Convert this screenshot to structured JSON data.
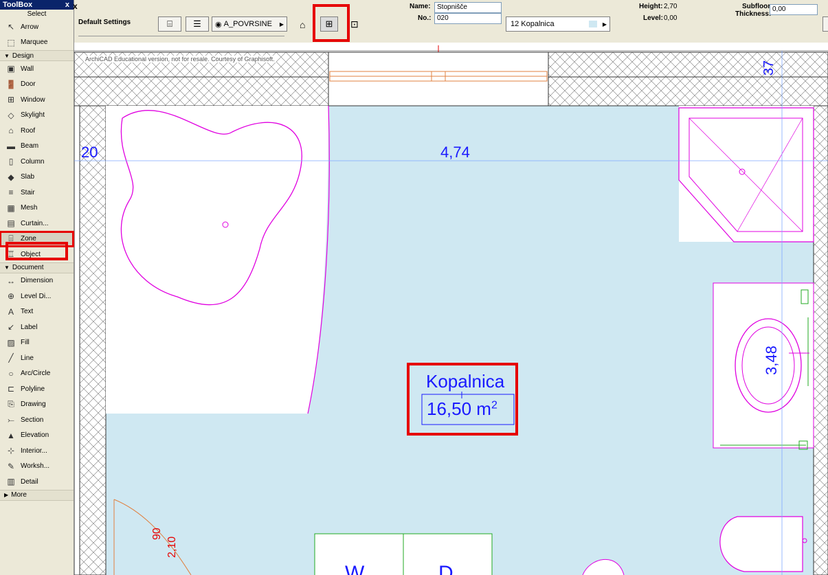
{
  "toolbox": {
    "title": "ToolBox",
    "close": "x",
    "select_label": "Select",
    "items_top": [
      {
        "label": "Arrow",
        "icon": "arrow-icon"
      },
      {
        "label": "Marquee",
        "icon": "marquee-icon"
      }
    ],
    "design_label": "Design",
    "design_items": [
      {
        "label": "Wall",
        "icon": "wall-icon"
      },
      {
        "label": "Door",
        "icon": "door-icon"
      },
      {
        "label": "Window",
        "icon": "window-icon"
      },
      {
        "label": "Skylight",
        "icon": "skylight-icon"
      },
      {
        "label": "Roof",
        "icon": "roof-icon"
      },
      {
        "label": "Beam",
        "icon": "beam-icon"
      },
      {
        "label": "Column",
        "icon": "column-icon"
      },
      {
        "label": "Slab",
        "icon": "slab-icon"
      },
      {
        "label": "Stair",
        "icon": "stair-icon"
      },
      {
        "label": "Mesh",
        "icon": "mesh-icon"
      },
      {
        "label": "Curtain...",
        "icon": "curtain-wall-icon"
      },
      {
        "label": "Zone",
        "icon": "zone-icon",
        "selected": true
      },
      {
        "label": "Object",
        "icon": "object-icon"
      }
    ],
    "document_label": "Document",
    "document_items": [
      {
        "label": "Dimension",
        "icon": "dimension-icon"
      },
      {
        "label": "Level Di...",
        "icon": "level-dimension-icon"
      },
      {
        "label": "Text",
        "icon": "text-icon"
      },
      {
        "label": "Label",
        "icon": "label-icon"
      },
      {
        "label": "Fill",
        "icon": "fill-icon"
      },
      {
        "label": "Line",
        "icon": "line-icon"
      },
      {
        "label": "Arc/Circle",
        "icon": "arc-circle-icon"
      },
      {
        "label": "Polyline",
        "icon": "polyline-icon"
      },
      {
        "label": "Drawing",
        "icon": "drawing-icon"
      },
      {
        "label": "Section",
        "icon": "section-icon"
      },
      {
        "label": "Elevation",
        "icon": "elevation-icon"
      },
      {
        "label": "Interior...",
        "icon": "interior-elevation-icon"
      },
      {
        "label": "Worksh...",
        "icon": "worksheet-icon"
      },
      {
        "label": "Detail",
        "icon": "detail-icon"
      }
    ],
    "more_label": "More"
  },
  "infobox": {
    "close": "x",
    "default_settings": "Default Settings",
    "layer": "A_POVRSINE",
    "name_label": "Name:",
    "name_value": "Stopnišče",
    "no_label": "No.:",
    "no_value": "020",
    "category": "12  Kopalnica",
    "height_label": "Height:",
    "height_value": "2,70",
    "level_label": "Level:",
    "level_value": "0,00",
    "subfloor_label1": "Subfloor",
    "subfloor_label2": "Thickness:",
    "subfloor_value": "0,00"
  },
  "drawing": {
    "watermark": "ArchiCAD Educational version, not for resale. Courtesy of Graphisoft.",
    "dim_width": "4,74",
    "dim_left": "20",
    "dim_top_right": "37",
    "dim_right": "3,48",
    "zone_name": "Kopalnica",
    "zone_area": "16,50 m",
    "zone_area_sup": "2",
    "door_dim1": "90",
    "door_dim2": "2,10",
    "bottom_w": "W",
    "bottom_d": "D",
    "zone_fill": "#cfe8f2",
    "accent": "#e60000",
    "fixture_color": "#e000e0",
    "dim_color": "#1a1aff"
  }
}
